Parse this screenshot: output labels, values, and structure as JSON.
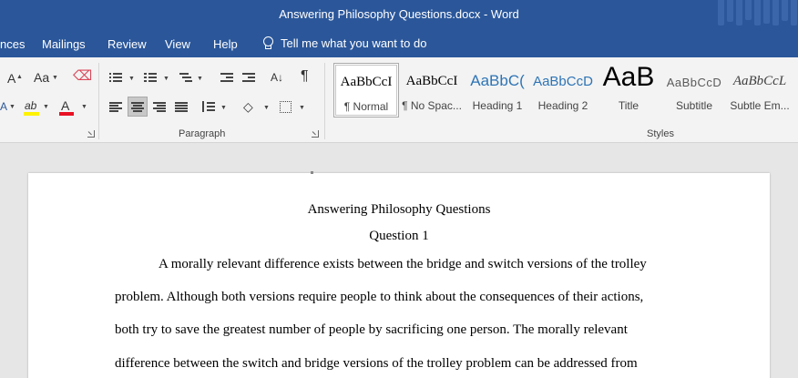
{
  "titlebar": {
    "title": "Answering Philosophy Questions.docx  -  Word"
  },
  "tabs": [
    {
      "label": "nces"
    },
    {
      "label": "Mailings"
    },
    {
      "label": "Review"
    },
    {
      "label": "View"
    },
    {
      "label": "Help"
    }
  ],
  "tellme": {
    "label": "Tell me what you want to do"
  },
  "ribbon": {
    "font_group": {
      "grow_label": "A",
      "case_label": "Aa",
      "highlight_label": "ab",
      "font_color_label": "A",
      "font_color": "#e81123",
      "highlight_color": "#fff200"
    },
    "paragraph_group": {
      "label": "Paragraph",
      "pilcrow": "¶"
    },
    "styles_group": {
      "label": "Styles",
      "items": [
        {
          "preview": "AaBbCcI",
          "name": "¶ Normal",
          "selected": true
        },
        {
          "preview": "AaBbCcI",
          "name": "¶ No Spac..."
        },
        {
          "preview": "AaBbC(",
          "name": "Heading 1"
        },
        {
          "preview": "AaBbCcD",
          "name": "Heading 2"
        },
        {
          "preview": "AaB",
          "name": "Title"
        },
        {
          "preview": "AaBbCcD",
          "name": "Subtitle"
        },
        {
          "preview": "AaBbCcL",
          "name": "Subtle Em..."
        }
      ],
      "heading_color": "#2e74b5"
    }
  },
  "document": {
    "title": "Answering Philosophy Questions",
    "question_heading": "Question 1",
    "lines": [
      "A morally relevant difference exists between the bridge and switch versions of the trolley",
      "problem. Although both versions require people to think about the consequences of their actions,",
      "both try to save the greatest number of people by sacrificing one person. The morally relevant",
      "difference between the switch and bridge versions of the trolley problem can be addressed from"
    ]
  }
}
